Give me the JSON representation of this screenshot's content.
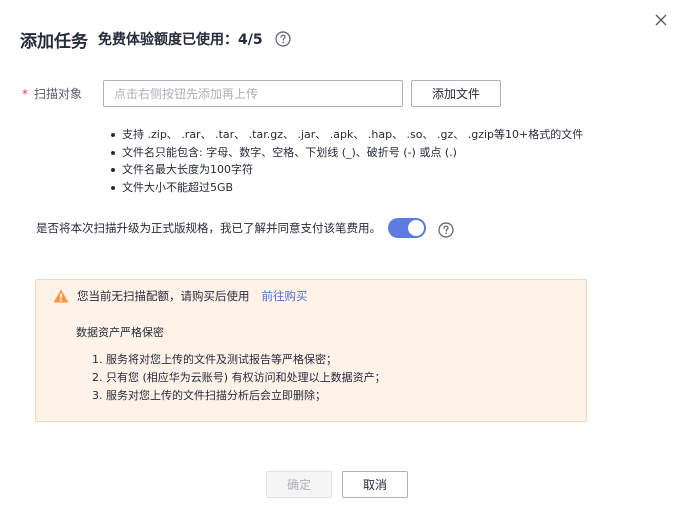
{
  "dialog": {
    "title": "添加任务",
    "quota": "免费体验额度已使用：4/5"
  },
  "scan": {
    "required_mark": "*",
    "label": "扫描对象",
    "placeholder": "点击右侧按钮先添加再上传",
    "value": "",
    "add_file_label": "添加文件"
  },
  "rules": [
    "支持 .zip、 .rar、 .tar、 .tar.gz、 .jar、 .apk、 .hap、 .so、 .gz、 .gzip等10+格式的文件",
    "文件名只能包含: 字母、数字、空格、下划线 (_)、破折号 (-) 或点 (.)",
    "文件名最大长度为100字符",
    "文件大小不能超过5GB"
  ],
  "upgrade": {
    "text": "是否将本次扫描升级为正式版规格，我已了解并同意支付该笔费用。",
    "enabled": true
  },
  "notice": {
    "message": "您当前无扫描配额，请购买后使用",
    "link": "前往购买",
    "subtitle": "数据资产严格保密",
    "items": [
      "1. 服务将对您上传的文件及测试报告等严格保密；",
      "2. 只有您 (相应华为云账号) 有权访问和处理以上数据资产；",
      "3. 服务对您上传的文件扫描分析后会立即删除；"
    ]
  },
  "footer": {
    "ok_label": "确定",
    "cancel_label": "取消"
  },
  "colors": {
    "accent": "#5e7ce0",
    "link": "#526ecc",
    "warning": "#fa9841",
    "notice_bg": "#fff2e8",
    "required": "#e54545"
  },
  "icons": {
    "close": "close-icon",
    "help": "help-circle-icon",
    "warning": "warning-triangle-icon"
  }
}
